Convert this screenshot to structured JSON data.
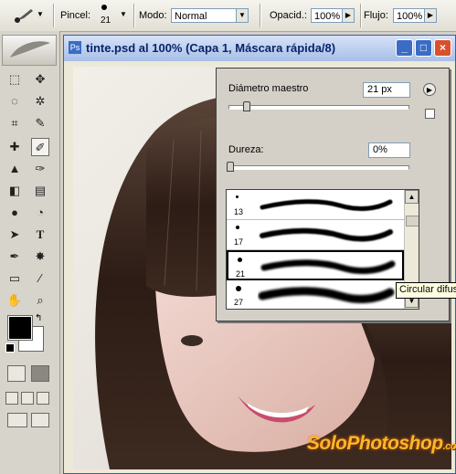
{
  "options_bar": {
    "brush_label": "Pincel:",
    "brush_size": "21",
    "mode_label": "Modo:",
    "mode_value": "Normal",
    "opacity_label": "Opacid.:",
    "opacity_value": "100%",
    "flow_label": "Flujo:",
    "flow_value": "100%"
  },
  "toolbox": {
    "tools": [
      "marquee",
      "move",
      "lasso",
      "magic-wand",
      "crop",
      "slice",
      "healing",
      "brush",
      "stamp",
      "history-brush",
      "eraser",
      "gradient",
      "blur",
      "dodge",
      "path-select",
      "type",
      "pen",
      "shape",
      "notes",
      "eyedropper",
      "hand",
      "zoom"
    ],
    "active_tool": "brush",
    "foreground_color": "#000000",
    "background_color": "#ffffff"
  },
  "document": {
    "title": "tinte.psd al 100% (Capa 1, Máscara rápida/8)",
    "minimize_label": "_",
    "maximize_label": "□",
    "close_label": "×"
  },
  "brush_popup": {
    "diameter_label": "Diámetro maestro",
    "diameter_value": "21 px",
    "diameter_fraction": 0.08,
    "hardness_label": "Dureza:",
    "hardness_value": "0%",
    "hardness_fraction": 0.0,
    "brushes": [
      {
        "size": "13",
        "selected": false
      },
      {
        "size": "17",
        "selected": false
      },
      {
        "size": "21",
        "selected": true
      },
      {
        "size": "27",
        "selected": false
      }
    ],
    "tooltip": "Circular difuso"
  },
  "watermark": {
    "text": "SoloPhotoshop",
    "suffix": ".com"
  },
  "colors": {
    "title_bar": "#a8bfe8",
    "close_button": "#d9512c",
    "window_button": "#3b6cc5"
  }
}
